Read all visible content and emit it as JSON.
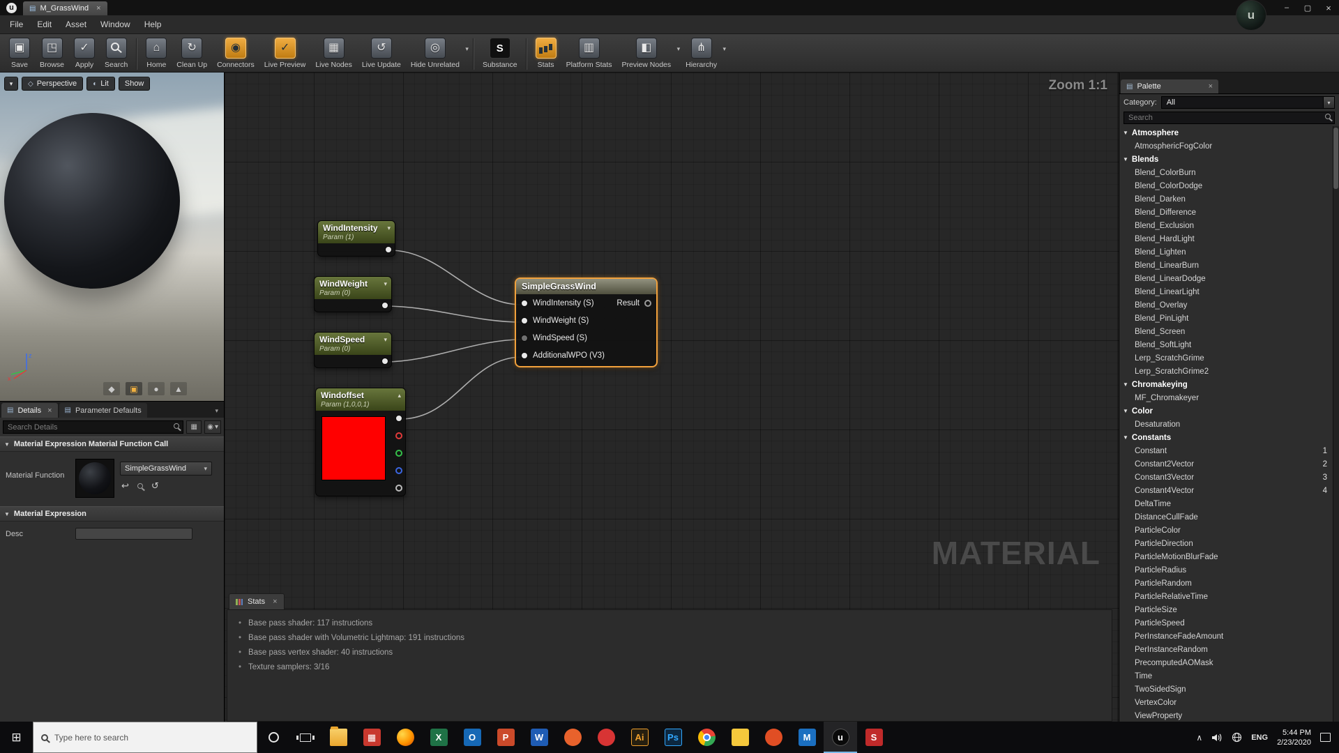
{
  "titlebar": {
    "tab_title": "M_GrassWind"
  },
  "menu": {
    "items": [
      "File",
      "Edit",
      "Asset",
      "Window",
      "Help"
    ]
  },
  "toolbar": {
    "buttons": [
      {
        "name": "save",
        "label": "Save",
        "icon": "floppy-icon",
        "glyph": "▣"
      },
      {
        "name": "browse",
        "label": "Browse",
        "icon": "browse-folder-icon",
        "glyph": "◳"
      },
      {
        "name": "apply",
        "label": "Apply",
        "icon": "apply-check-icon",
        "glyph": "✓"
      },
      {
        "name": "search",
        "label": "Search",
        "icon": "search-icon",
        "shape": "mag"
      },
      {
        "name": "home",
        "label": "Home",
        "icon": "home-icon",
        "glyph": "⌂",
        "sep": true
      },
      {
        "name": "clean-up",
        "label": "Clean Up",
        "icon": "clean-up-icon",
        "glyph": "↻"
      },
      {
        "name": "connectors",
        "label": "Connectors",
        "icon": "connectors-icon",
        "glyph": "◉",
        "hl": true
      },
      {
        "name": "live-preview",
        "label": "Live Preview",
        "icon": "live-preview-check-icon",
        "glyph": "✓",
        "hl": true
      },
      {
        "name": "live-nodes",
        "label": "Live Nodes",
        "icon": "live-nodes-icon",
        "glyph": "▦"
      },
      {
        "name": "live-update",
        "label": "Live Update",
        "icon": "live-update-icon",
        "glyph": "↺"
      },
      {
        "name": "hide-unrelated",
        "label": "Hide Unrelated",
        "icon": "hide-unrelated-icon",
        "glyph": "◎",
        "dd": true
      },
      {
        "name": "substance",
        "label": "Substance",
        "icon": "substance-icon",
        "glyph": "S",
        "tile": "sub",
        "sep": true
      },
      {
        "name": "stats",
        "label": "Stats",
        "icon": "stats-chart-icon",
        "shape": "bars",
        "hl": true,
        "sep": true
      },
      {
        "name": "platform-stats",
        "label": "Platform Stats",
        "icon": "platform-stats-icon",
        "glyph": "▥"
      },
      {
        "name": "preview-nodes",
        "label": "Preview Nodes",
        "icon": "preview-nodes-icon",
        "glyph": "◧",
        "dd": true
      },
      {
        "name": "hierarchy",
        "label": "Hierarchy",
        "icon": "hierarchy-icon",
        "glyph": "⋔",
        "dd": true
      }
    ]
  },
  "viewport": {
    "perspective": "Perspective",
    "lit": "Lit",
    "show": "Show",
    "tool_icons": [
      "◆",
      "▣",
      "●",
      "▲"
    ],
    "axis_z": "z",
    "axis_x": "x"
  },
  "details": {
    "tabs": [
      "Details",
      "Parameter Defaults"
    ],
    "search_placeholder": "Search Details",
    "section_function_call": "Material Expression Material Function Call",
    "material_function_label": "Material Function",
    "material_function_value": "SimpleGrassWind",
    "section_expression": "Material Expression",
    "desc_label": "Desc"
  },
  "graph": {
    "zoom_label": "Zoom 1:1",
    "watermark": "MATERIAL",
    "nodes": {
      "wind_intensity": {
        "title": "WindIntensity",
        "subtitle": "Param (1)"
      },
      "wind_weight": {
        "title": "WindWeight",
        "subtitle": "Param (0)"
      },
      "wind_speed": {
        "title": "WindSpeed",
        "subtitle": "Param (0)"
      },
      "windoffset": {
        "title": "Windoffset",
        "subtitle": "Param (1,0,0,1)",
        "swatch_color": "#ff0000"
      },
      "function": {
        "title": "SimpleGrassWind",
        "inputs": [
          "WindIntensity (S)",
          "WindWeight (S)",
          "WindSpeed (S)",
          "AdditionalWPO (V3)"
        ],
        "output": "Result"
      }
    }
  },
  "stats_panel": {
    "tab": "Stats",
    "lines": [
      "Base pass shader: 117 instructions",
      "Base pass shader with Volumetric Lightmap: 191 instructions",
      "Base pass vertex shader: 40 instructions",
      "Texture samplers: 3/16"
    ]
  },
  "palette": {
    "tab": "Palette",
    "category_label": "Category:",
    "category_value": "All",
    "search_placeholder": "Search",
    "items": [
      {
        "t": "cat",
        "label": "Atmosphere"
      },
      {
        "t": "item",
        "label": "AtmosphericFogColor"
      },
      {
        "t": "cat",
        "label": "Blends"
      },
      {
        "t": "item",
        "label": "Blend_ColorBurn"
      },
      {
        "t": "item",
        "label": "Blend_ColorDodge"
      },
      {
        "t": "item",
        "label": "Blend_Darken"
      },
      {
        "t": "item",
        "label": "Blend_Difference"
      },
      {
        "t": "item",
        "label": "Blend_Exclusion"
      },
      {
        "t": "item",
        "label": "Blend_HardLight"
      },
      {
        "t": "item",
        "label": "Blend_Lighten"
      },
      {
        "t": "item",
        "label": "Blend_LinearBurn"
      },
      {
        "t": "item",
        "label": "Blend_LinearDodge"
      },
      {
        "t": "item",
        "label": "Blend_LinearLight"
      },
      {
        "t": "item",
        "label": "Blend_Overlay"
      },
      {
        "t": "item",
        "label": "Blend_PinLight"
      },
      {
        "t": "item",
        "label": "Blend_Screen"
      },
      {
        "t": "item",
        "label": "Blend_SoftLight"
      },
      {
        "t": "item",
        "label": "Lerp_ScratchGrime"
      },
      {
        "t": "item",
        "label": "Lerp_ScratchGrime2"
      },
      {
        "t": "cat",
        "label": "Chromakeying"
      },
      {
        "t": "item",
        "label": "MF_Chromakeyer"
      },
      {
        "t": "cat",
        "label": "Color"
      },
      {
        "t": "item",
        "label": "Desaturation"
      },
      {
        "t": "cat",
        "label": "Constants"
      },
      {
        "t": "item",
        "label": "Constant",
        "badge": "1"
      },
      {
        "t": "item",
        "label": "Constant2Vector",
        "badge": "2"
      },
      {
        "t": "item",
        "label": "Constant3Vector",
        "badge": "3"
      },
      {
        "t": "item",
        "label": "Constant4Vector",
        "badge": "4"
      },
      {
        "t": "item",
        "label": "DeltaTime"
      },
      {
        "t": "item",
        "label": "DistanceCullFade"
      },
      {
        "t": "item",
        "label": "ParticleColor"
      },
      {
        "t": "item",
        "label": "ParticleDirection"
      },
      {
        "t": "item",
        "label": "ParticleMotionBlurFade"
      },
      {
        "t": "item",
        "label": "ParticleRadius"
      },
      {
        "t": "item",
        "label": "ParticleRandom"
      },
      {
        "t": "item",
        "label": "ParticleRelativeTime"
      },
      {
        "t": "item",
        "label": "ParticleSize"
      },
      {
        "t": "item",
        "label": "ParticleSpeed"
      },
      {
        "t": "item",
        "label": "PerInstanceFadeAmount"
      },
      {
        "t": "item",
        "label": "PerInstanceRandom"
      },
      {
        "t": "item",
        "label": "PrecomputedAOMask"
      },
      {
        "t": "item",
        "label": "Time"
      },
      {
        "t": "item",
        "label": "TwoSidedSign"
      },
      {
        "t": "item",
        "label": "VertexColor"
      },
      {
        "t": "item",
        "label": "ViewProperty"
      }
    ]
  },
  "taskbar": {
    "search_placeholder": "Type here to search",
    "tray": {
      "lang": "ENG",
      "time": "5:44 PM",
      "date": "2/23/2020"
    },
    "apps": [
      {
        "name": "file-explorer",
        "cls": "folder"
      },
      {
        "name": "store",
        "bg": "#c8382e",
        "glyph": "▦",
        "fg": "#ffffff"
      },
      {
        "name": "firefox",
        "cls": "firefox"
      },
      {
        "name": "excel",
        "bg": "#1f7246",
        "glyph": "X",
        "fg": "#ffffff"
      },
      {
        "name": "outlook",
        "bg": "#1668b5",
        "glyph": "O",
        "fg": "#ffffff"
      },
      {
        "name": "powerpoint",
        "bg": "#cb4a2a",
        "glyph": "P",
        "fg": "#ffffff"
      },
      {
        "name": "word",
        "bg": "#1f5cb4",
        "glyph": "W",
        "fg": "#ffffff"
      },
      {
        "name": "brave",
        "bg": "#e8622c",
        "glyph": "",
        "round": true
      },
      {
        "name": "red-browser",
        "bg": "#d83434",
        "glyph": "",
        "round": true
      },
      {
        "name": "illustrator",
        "bg": "#261f10",
        "glyph": "Ai",
        "fg": "#f0a02c",
        "border": "#f0a02c"
      },
      {
        "name": "photoshop",
        "bg": "#0d2840",
        "glyph": "Ps",
        "fg": "#31a8ff",
        "border": "#31a8ff"
      },
      {
        "name": "chrome",
        "cls": "chrome"
      },
      {
        "name": "sticky-notes",
        "bg": "#f5c83c",
        "glyph": "",
        "fg": "#333333"
      },
      {
        "name": "orange-app",
        "bg": "#e04e24",
        "glyph": "",
        "round": true
      },
      {
        "name": "m-app",
        "bg": "#1b6fc0",
        "glyph": "M",
        "fg": "#ffffff"
      },
      {
        "name": "unreal-engine",
        "bg": "#0a0a0a",
        "glyph": "u",
        "fg": "#ffffff",
        "round": true,
        "active": true,
        "border": "#555555"
      },
      {
        "name": "substance-painter",
        "bg": "#c02a2a",
        "glyph": "S",
        "fg": "#ffffff"
      }
    ]
  },
  "icons": {
    "close": "×",
    "minimize": "–",
    "maximize": "▢",
    "dropdown": "▾",
    "expand_up": "▴",
    "expand_down": "▾",
    "category_tri": "▼",
    "bullet": "•",
    "caret_up": "∧",
    "back_arrow": "↩",
    "reset": "↺",
    "start": "⊞",
    "doc": "▤",
    "grid": "▦",
    "eye": "◉",
    "logo_letter": "u",
    "perspective_glyph": "◇",
    "lit_glyph": "◐"
  },
  "colors": {
    "accent_orange": "#cf8a28",
    "selection_orange": "#f2a13c",
    "param_header_green": "#68763c",
    "wire": "#b5b5b5",
    "vector_red": "#ff0000"
  }
}
